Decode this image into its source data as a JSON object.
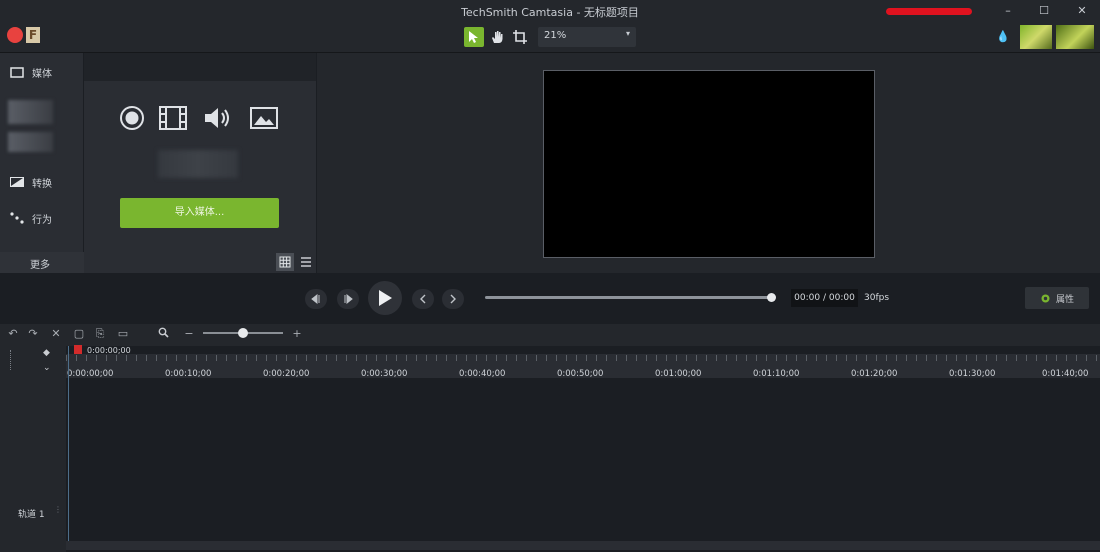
{
  "window": {
    "title": "TechSmith Camtasia - 无标题项目",
    "controls": [
      "–",
      "☐",
      "✕"
    ]
  },
  "toolbar": {
    "zoom": "21%",
    "tools": [
      "select-tool",
      "pan-tool",
      "crop-tool"
    ]
  },
  "left_nav": {
    "items": [
      {
        "icon": "media-icon",
        "label": "媒体"
      },
      {
        "icon": "transitions-icon",
        "label": "转换"
      },
      {
        "icon": "behaviors-icon",
        "label": "行为"
      }
    ],
    "more_label": "更多",
    "add_symbol": "+"
  },
  "media_panel": {
    "icons": [
      "record-icon",
      "video-icon",
      "audio-icon",
      "image-icon"
    ],
    "import_label": "导入媒体..."
  },
  "playback": {
    "time": "00:00 / 00:00",
    "fps": "30fps",
    "properties_label": "属性",
    "progress": 1.0
  },
  "timeline": {
    "playhead_time": "0:00:00;00",
    "ticks": [
      "0:00:00;00",
      "0:00:10;00",
      "0:00:20;00",
      "0:00:30;00",
      "0:00:40;00",
      "0:00:50;00",
      "0:01:00;00",
      "0:01:10;00",
      "0:01:20;00",
      "0:01:30;00",
      "0:01:40;00"
    ],
    "track_label": "轨道 1",
    "zoom_minus": "−",
    "zoom_plus": "+"
  },
  "colors": {
    "accent_green": "#7ab62f",
    "background": "#1b1e23",
    "playhead_red": "#d22b2b"
  }
}
